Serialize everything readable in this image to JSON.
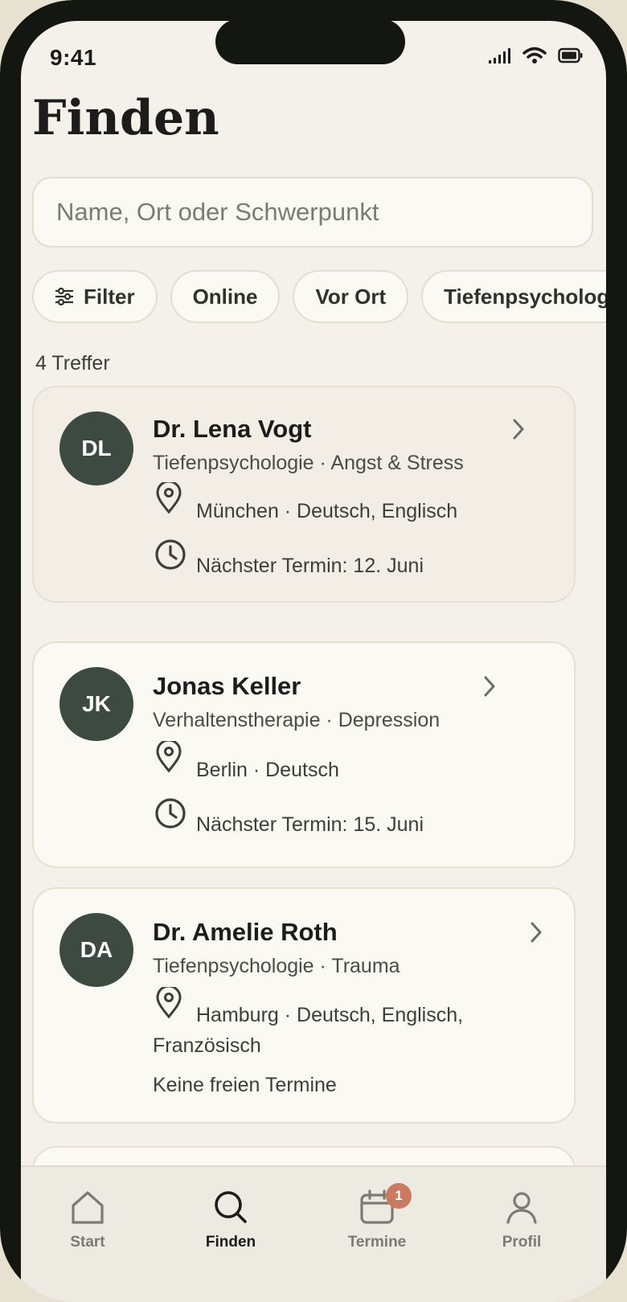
{
  "status_bar": {
    "time": "9:41"
  },
  "page": {
    "title": "Finden"
  },
  "search": {
    "placeholder": "Name, Ort oder Schwerpunkt",
    "value": ""
  },
  "chips": [
    {
      "label": "Filter",
      "icon": "sliders-icon"
    },
    {
      "label": "Online"
    },
    {
      "label": "Vor Ort"
    },
    {
      "label": "Tiefenpsychologie"
    }
  ],
  "results": {
    "count_text": "4 Treffer",
    "items": [
      {
        "initials": "DL",
        "name": "Dr. Lena Vogt",
        "specialty": "Tiefenpsychologie · Angst & Stress",
        "location": "München · Deutsch, Englisch",
        "next_appointment": "Nächster Termin: 12. Juni",
        "selected": true
      },
      {
        "initials": "JK",
        "name": "Jonas Keller",
        "specialty": "Verhaltenstherapie · Depression",
        "location": "Berlin · Deutsch",
        "next_appointment": "Nächster Termin: 15. Juni"
      },
      {
        "initials": "DA",
        "name": "Dr. Amelie Roth",
        "specialty": "Tiefenpsychologie · Trauma",
        "location": "Hamburg · Deutsch, Englisch, Französisch",
        "no_appointment": "Keine freien Termine"
      }
    ]
  },
  "tabbar": {
    "items": [
      {
        "label": "Start",
        "icon": "home-icon"
      },
      {
        "label": "Finden",
        "icon": "search-icon",
        "active": true
      },
      {
        "label": "Termine",
        "icon": "calendar-icon",
        "badge": "1"
      },
      {
        "label": "Profil",
        "icon": "user-icon"
      }
    ]
  },
  "colors": {
    "avatar": "#3c4a42",
    "badge": "#c97a60",
    "background": "#f4f1ea"
  }
}
